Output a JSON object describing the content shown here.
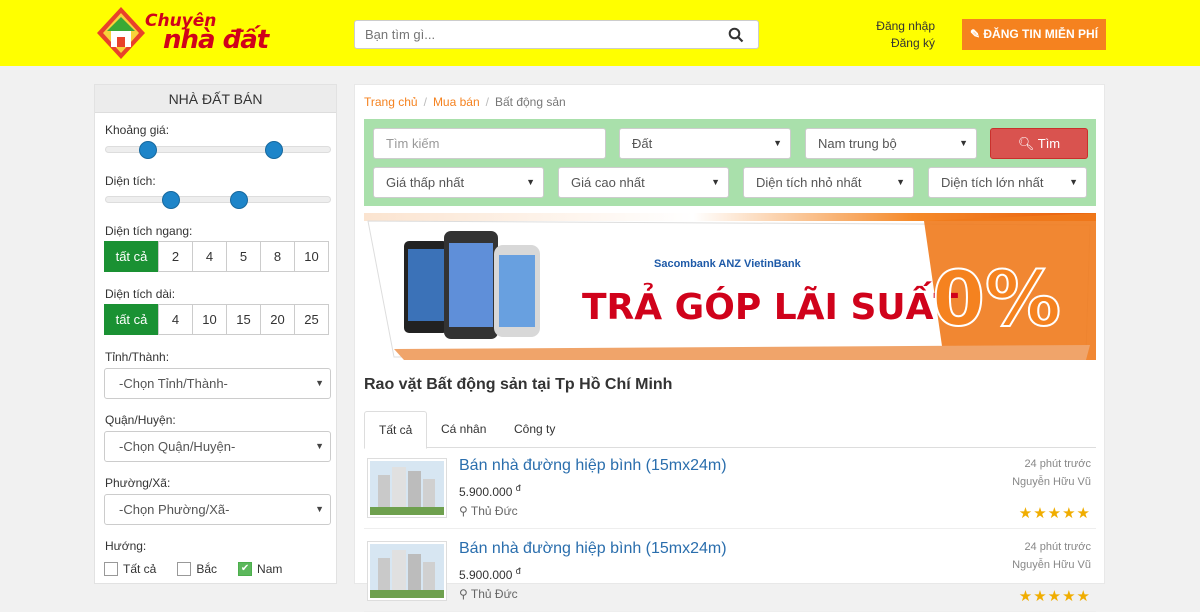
{
  "header": {
    "logo_line1": "Chuyên",
    "logo_line2": "nhà đất",
    "logo_small": "Chuyên nhà đất",
    "search_placeholder": "Bạn tìm gì...",
    "login": "Đăng nhập",
    "register": "Đăng ký",
    "post_button": "ĐĂNG TIN MIỄN PHÍ"
  },
  "sidebar": {
    "title": "NHÀ ĐẤT BÁN",
    "price_label": "Khoảng giá:",
    "area_label": "Diện tích:",
    "width_label": "Diện tích ngang:",
    "width_options": [
      "tất cả",
      "2",
      "4",
      "5",
      "8",
      "10"
    ],
    "length_label": "Diện tích dài:",
    "length_options": [
      "tất cả",
      "4",
      "10",
      "15",
      "20",
      "25"
    ],
    "province_label": "Tỉnh/Thành:",
    "province_value": "-Chọn Tỉnh/Thành-",
    "district_label": "Quận/Huyện:",
    "district_value": "-Chọn Quận/Huyện-",
    "ward_label": "Phường/Xã:",
    "ward_value": "-Chọn Phường/Xã-",
    "direction_label": "Hướng:",
    "directions": [
      "Tất cả",
      "Bắc",
      "Nam"
    ]
  },
  "breadcrumb": [
    "Trang chủ",
    "Mua bán",
    "Bất động sản"
  ],
  "filters": {
    "search_placeholder": "Tìm kiếm",
    "type": "Đất",
    "region": "Nam trung bộ",
    "find_button": "Tìm",
    "min_price": "Giá thấp nhất",
    "max_price": "Giá cao nhất",
    "min_area": "Diện tích nhỏ nhất",
    "max_area": "Diện tích lớn nhất"
  },
  "banner": {
    "banks": "Sacombank  ANZ  VietinBank",
    "text": "TRẢ GÓP LÃI SUẤT",
    "rate": "0%"
  },
  "listing": {
    "heading": "Rao vặt Bất động sản tại Tp Hồ Chí Minh",
    "tabs": [
      "Tất cả",
      "Cá nhân",
      "Công ty"
    ],
    "items": [
      {
        "title": "Bán nhà đường hiệp bình (15mx24m)",
        "price": "5.900.000",
        "currency": "đ",
        "location": "Thủ Đức",
        "time": "24 phút trước",
        "user": "Nguyễn Hữu Vũ",
        "stars": "★★★★★"
      },
      {
        "title": "Bán nhà đường hiệp bình (15mx24m)",
        "price": "5.900.000",
        "currency": "đ",
        "location": "Thủ Đức",
        "time": "24 phút trước",
        "user": "Nguyễn Hữu Vũ",
        "stars": "★★★★★"
      }
    ]
  },
  "colors": {
    "header": "#ffff00",
    "accent": "#f5821f",
    "active": "#1a9133",
    "slider": "#1e85c9",
    "filter_bg": "#a9e0ab"
  }
}
